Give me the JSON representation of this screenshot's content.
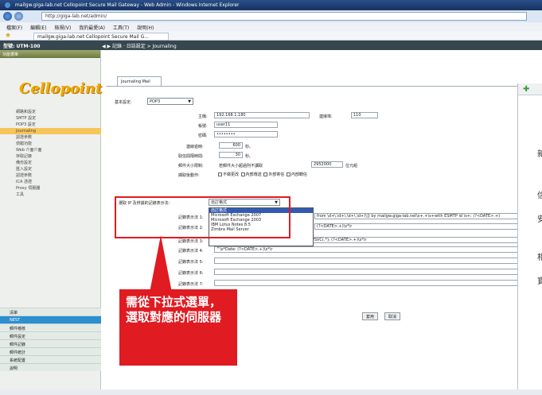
{
  "browser": {
    "title": "mailgw.giga-lab.net Cellopoint Secure Mail Gateway - Web Admin - Windows Internet Explorer",
    "address": "http://giga-lab.net/admin/",
    "menu": [
      "檔案(F)",
      "編輯(E)",
      "檢視(V)",
      "我的最愛(A)",
      "工具(T)",
      "說明(H)"
    ],
    "tab_label": "mailgw.giga-lab.net Cellopoint Secure Mail G..."
  },
  "header": {
    "brand": "型號: UTM-100",
    "breadcrumb": "◀ ▶ 記錄 · 日誌設定 > Journaling"
  },
  "sidebar": {
    "top_label": "功能選單",
    "logo": "Cellopoint",
    "items": [
      "網路和設定",
      "SMTP 設定",
      "POP3 設定",
      "Journaling",
      "認證參數",
      "偵錯功能",
      "Web 介面介面",
      "存取記錄",
      "備份設定",
      "匯入設定",
      "認證參數",
      "ICA 憑證",
      "Proxy 伺服器",
      "工具"
    ],
    "active_index": 3,
    "bottom_items": [
      "清單",
      "NEST",
      "郵件稽核",
      "郵件設定",
      "郵件記錄",
      "郵件統計",
      "系統配置",
      "說明"
    ],
    "bottom_selected": 1
  },
  "form": {
    "tab": "Journaling Mail",
    "basic_label": "基本設定:",
    "basic_value": "POP3",
    "host_label": "主機:",
    "host_value": "192.168.1.180",
    "port_label": "連接埠:",
    "port_value": "110",
    "account_label": "帳號:",
    "account_value": "user11",
    "password_label": "密碼:",
    "password_value": "••••••••",
    "timeout_label": "連線逾時:",
    "timeout_value": "600",
    "unit_seconds": "秒。",
    "interval_label": "取信間隔時間:",
    "interval_value": "30",
    "limit_label": "郵件大小限制:",
    "limit_text": "若郵件大小超過則不讀取",
    "limit_value": "2952000",
    "limit_suffix": "位元組",
    "attach_label": "擷取後動作:",
    "attach_options": [
      "不做更改",
      "內部傳送",
      "外部寄信",
      "內部轉信"
    ],
    "method_label": "選取 IP 及辨識的記錄表示法:",
    "method_value": "自訂格式",
    "dropdown": [
      "自訂格式",
      "Microsoft Exchange 2007",
      "Microsoft Exchange 2003",
      "IBM Lotus Notes 8.5",
      "Zimbra Mail Server"
    ],
    "dropdown_highlight": 0,
    "regex_label_1": "記錄表示法 1:",
    "regex_value_1": "from \\d+\\.\\d+\\.\\d+\\.\\d+)\\]) by mailgw.giga-lab.net\\s+.+\\s+with ESMTP id \\s+; (?<DATE>.+)",
    "regex_label_2": "記錄表示法 2:",
    "regex_value_2": "(?<DATE>.+)\\s*\\r",
    "regex_label_3": "記錄表示法 3:",
    "regex_value_3": "+\\d+\\.\\d+\\.\\d+\\.\\d+)\\]) by .* with Microsoft SMTPSVC(.*); (?<DATE>.+)\\s*\\r",
    "regex_label_4": "記錄表示法 4:",
    "regex_value_4": "^\\s*Date: (?<DATE>.+)\\s*\\r",
    "regex_label_5": "記錄表示法 5:",
    "regex_label_6": "記錄表示法 6:",
    "regex_label_7": "記錄表示法 7:",
    "apply": "套用",
    "cancel": "取消"
  },
  "callout": {
    "text": "需從下拉式選單，選取對應的伺服器"
  },
  "dialog": {
    "chars": [
      "新",
      "信",
      "安",
      "相",
      "寶"
    ]
  },
  "colors": {
    "highlight_red": "#e01b22",
    "logo_gold": "#f2a900",
    "header_dark": "#37474f"
  }
}
